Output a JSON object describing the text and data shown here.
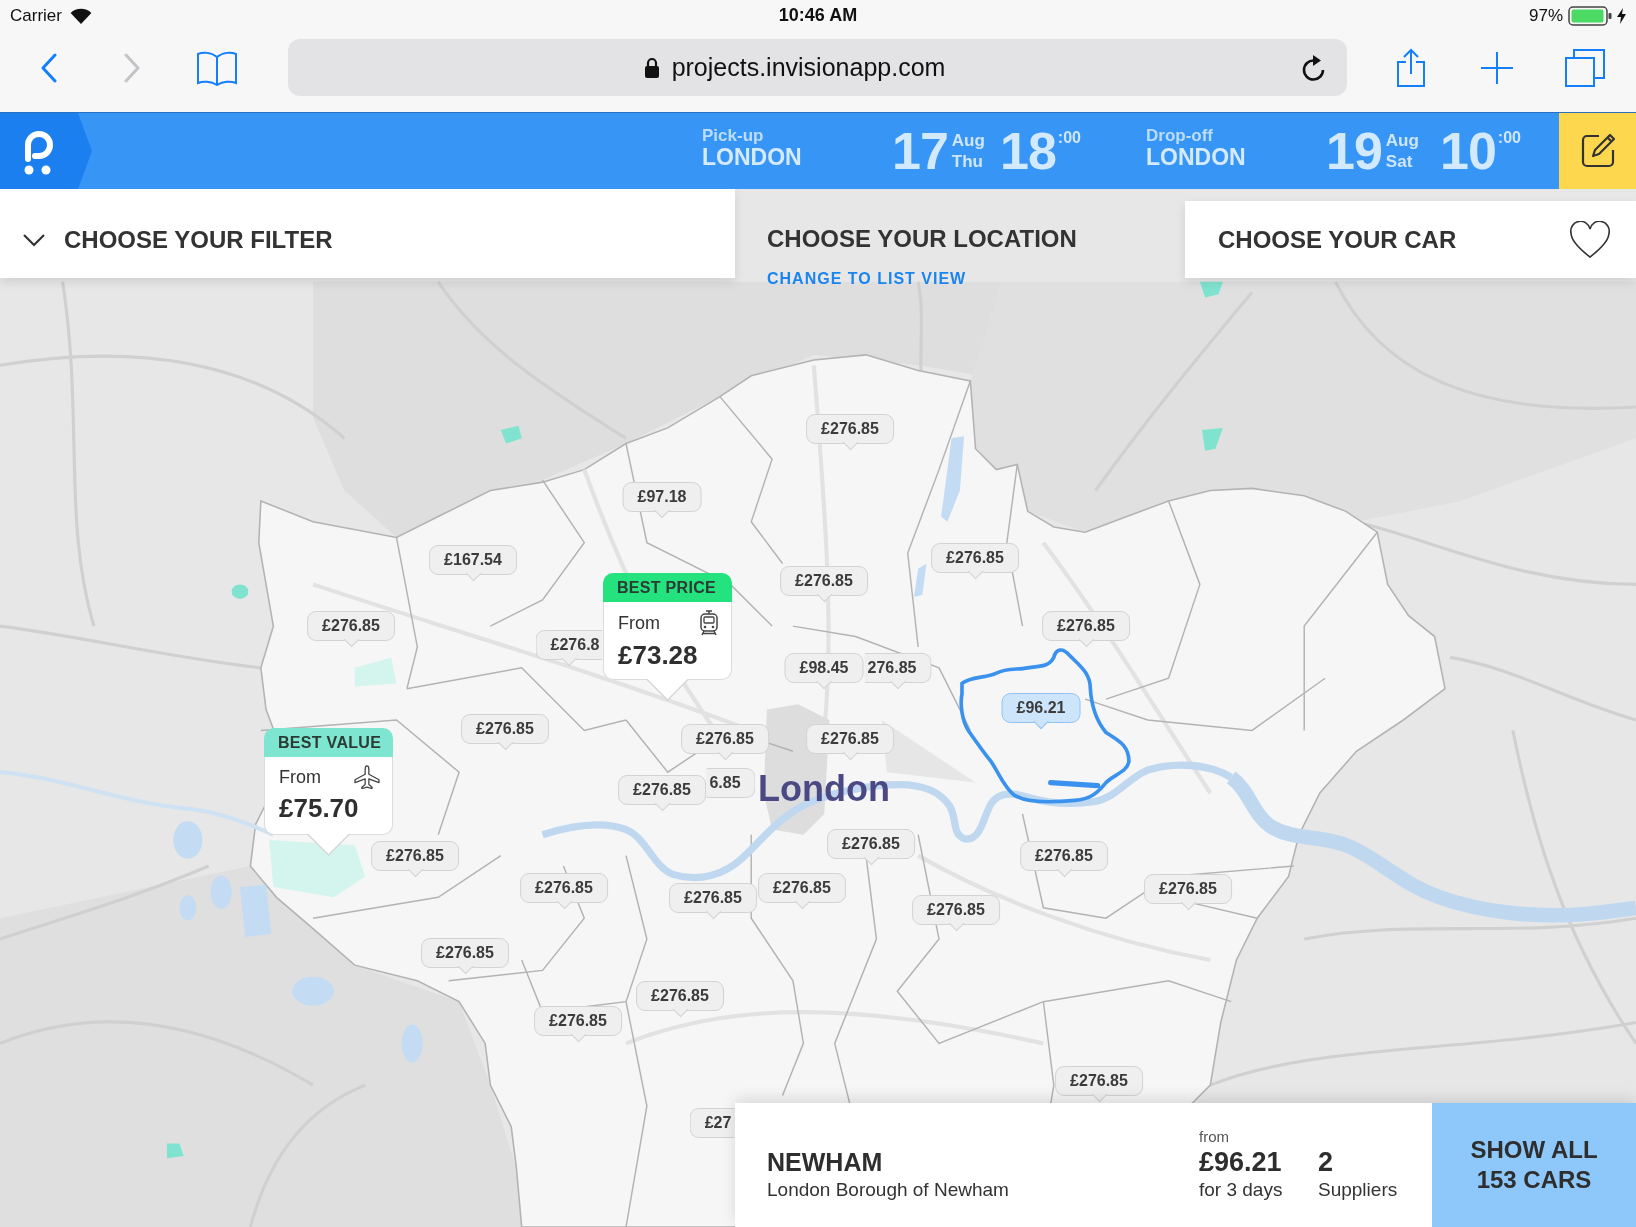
{
  "status_bar": {
    "carrier": "Carrier",
    "time": "10:46 AM",
    "battery": "97%"
  },
  "browser": {
    "back": {
      "disabled": false
    },
    "forward": {
      "disabled": true
    },
    "url": "projects.invisionapp.com"
  },
  "header": {
    "pickup": {
      "label": "Pick-up",
      "city": "LONDON",
      "day": "17",
      "month": "Aug",
      "weekday": "Thu",
      "hour": "18",
      "minutes": ":00"
    },
    "dropoff": {
      "label": "Drop-off",
      "city": "LONDON",
      "day": "19",
      "month": "Aug",
      "weekday": "Sat",
      "hour": "10",
      "minutes": ":00"
    }
  },
  "steps": [
    {
      "kind": "filter",
      "title": "CHOOSE YOUR FILTER",
      "selected": false
    },
    {
      "kind": "location",
      "title": "CHOOSE YOUR LOCATION",
      "link": "CHANGE TO LIST VIEW",
      "selected": true
    },
    {
      "kind": "car",
      "title": "CHOOSE YOUR CAR",
      "selected": false
    }
  ],
  "map": {
    "city_label": "London",
    "pins": [
      {
        "price": "£276.85",
        "selected": false
      },
      {
        "price": "£97.18",
        "selected": false
      },
      {
        "price": "£167.54",
        "selected": false
      },
      {
        "price": "£276.85",
        "selected": false
      },
      {
        "price": "£276.85",
        "selected": false
      },
      {
        "price": "£276.85",
        "selected": false
      },
      {
        "price": "£276.85",
        "selected": false
      },
      {
        "price": "£276.8",
        "selected": false
      },
      {
        "price": "£98.45",
        "selected": false
      },
      {
        "price": "276.85",
        "selected": false
      },
      {
        "price": "£96.21",
        "selected": true
      },
      {
        "price": "£276.85",
        "selected": false
      },
      {
        "price": "£276.85",
        "selected": false
      },
      {
        "price": "£276.85",
        "selected": false
      },
      {
        "price": "6.85",
        "selected": false
      },
      {
        "price": "£276.85",
        "selected": false
      },
      {
        "price": "£276.85",
        "selected": false
      },
      {
        "price": "£276.85",
        "selected": false
      },
      {
        "price": "£276.85",
        "selected": false
      },
      {
        "price": "£276.85",
        "selected": false
      },
      {
        "price": "£276.85",
        "selected": false
      },
      {
        "price": "£276.85",
        "selected": false
      },
      {
        "price": "£276.85",
        "selected": false
      },
      {
        "price": "£276.85",
        "selected": false
      },
      {
        "price": "£276.85",
        "selected": false
      },
      {
        "price": "£276.85",
        "selected": false
      },
      {
        "price": "£276.85",
        "selected": false
      },
      {
        "price": "£276.85",
        "selected": false
      },
      {
        "price": "£27",
        "selected": false
      }
    ],
    "deals": [
      {
        "kind": "train",
        "tag": "BEST PRICE",
        "color": "#24e27e",
        "from": "From",
        "price": "£73.28"
      },
      {
        "kind": "plane",
        "tag": "BEST VALUE",
        "color": "#7ee5d0",
        "from": "From",
        "price": "£75.70"
      }
    ]
  },
  "selection": {
    "name": "NEWHAM",
    "subtitle": "London Borough of Newham",
    "price_caption": "from",
    "price": "£96.21",
    "duration": "for 3 days",
    "suppliers": "2",
    "suppliers_label": "Suppliers",
    "button": "SHOW ALL 153 CARS"
  }
}
